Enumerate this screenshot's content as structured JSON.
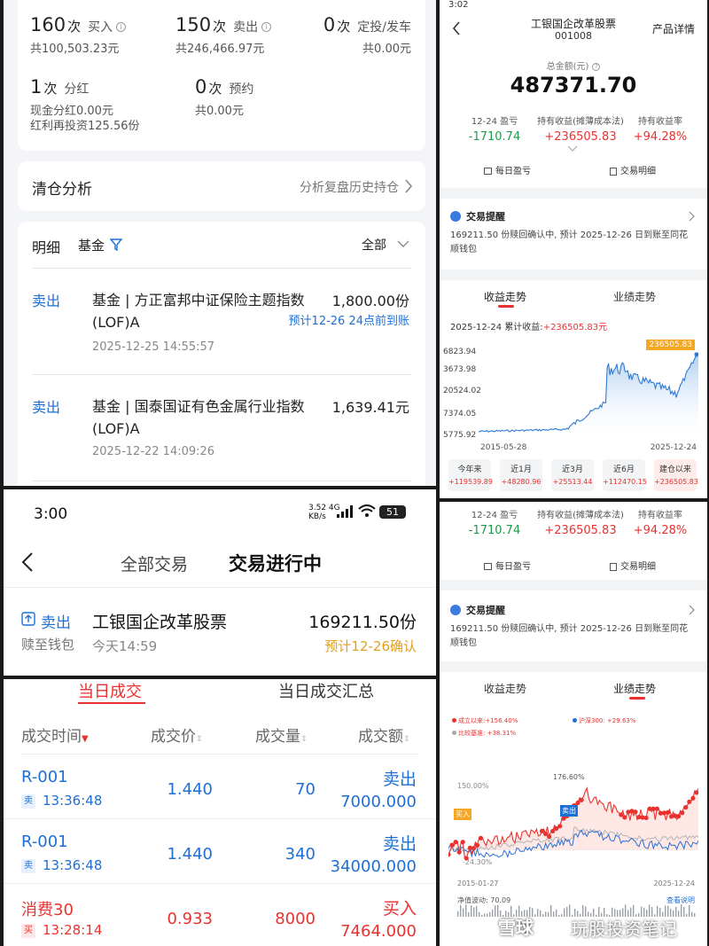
{
  "panel_a": {
    "stats": [
      {
        "count": "160",
        "unit": "次",
        "label": "买入",
        "sub": "共100,503.23元"
      },
      {
        "count": "150",
        "unit": "次",
        "label": "卖出",
        "sub": "共246,466.97元"
      },
      {
        "count": "0",
        "unit": "次",
        "label": "定投/发车",
        "sub": "共0.00元"
      },
      {
        "count": "1",
        "unit": "次",
        "label": "分红",
        "sub": "现金分红0.00元",
        "sub2": "红利再投资125.56份"
      },
      {
        "count": "0",
        "unit": "次",
        "label": "预约",
        "sub": "共0.00元"
      }
    ],
    "clear_title": "清仓分析",
    "clear_link": "分析复盘历史持仓",
    "detail_title": "明细",
    "detail_filter": "基金",
    "detail_all": "全部",
    "transactions": [
      {
        "action": "卖出",
        "name": "基金 | 方正富邦中证保险主题指数(LOF)A",
        "amount": "1,800.00份",
        "note": "预计12-26 24点前到账",
        "time": "2025-12-25 14:55:57"
      },
      {
        "action": "卖出",
        "name": "基金 | 国泰国证有色金属行业指数(LOF)A",
        "amount": "1,639.41元",
        "note": "",
        "time": "2025-12-22 14:09:26"
      }
    ]
  },
  "panel_b": {
    "status_time": "3:02",
    "fund_name": "工银国企改革股票",
    "fund_code": "001008",
    "detail_link": "产品详情",
    "total_label": "总金额(元)",
    "total_value": "487371.70",
    "metrics": [
      {
        "label": "12-24 盈亏",
        "value": "-1710.74"
      },
      {
        "label": "持有收益(摊薄成本法)",
        "value": "+236505.83"
      },
      {
        "label": "持有收益率",
        "value": "+94.28%"
      }
    ],
    "btn_daily": "每日盈亏",
    "btn_trade": "交易明细",
    "notice_title": "交易提醒",
    "notice_text": "169211.50 份赎回确认中, 预计 2025-12-26 日到账至同花顺钱包",
    "tab_profit": "收益走势",
    "tab_perf": "业绩走势",
    "chart_date": "2025-12-24",
    "chart_cum_label": "累计收益:",
    "chart_cum_value": "+236505.83元",
    "y_labels": [
      "6823.94",
      "3673.98",
      "20524.02",
      "7374.05",
      "5775.92"
    ],
    "x_start": "2015-05-28",
    "x_end": "2025-12-24",
    "badge": "236505.83",
    "periods": [
      {
        "label": "今年来",
        "value": "+119539.89"
      },
      {
        "label": "近1月",
        "value": "+48280.96"
      },
      {
        "label": "近3月",
        "value": "+25513.44"
      },
      {
        "label": "近6月",
        "value": "+112470.15"
      },
      {
        "label": "建仓以来",
        "value": "+236505.83"
      }
    ]
  },
  "panel_c": {
    "time": "3:00",
    "net_speed": "3.52",
    "net_unit": "KB/s",
    "net_type": "4G",
    "battery": "51",
    "tab_all": "全部交易",
    "tab_active": "交易进行中",
    "action": "卖出",
    "fund_name": "工银国企改革股票",
    "amount": "169211.50份",
    "sub_left": "赎至钱包",
    "sub_time": "今天14:59",
    "sub_right": "预计12-26确认"
  },
  "panel_d": {
    "tab1": "当日成交",
    "tab2": "当日成交汇总",
    "headers": [
      "成交时间",
      "成交价",
      "成交量",
      "成交额"
    ],
    "rows": [
      {
        "code": "R-001",
        "side": "卖",
        "time": "13:36:48",
        "price": "1.440",
        "qty": "70",
        "dir": "卖出",
        "amount": "7000.000",
        "color": "blue"
      },
      {
        "code": "R-001",
        "side": "卖",
        "time": "13:36:48",
        "price": "1.440",
        "qty": "340",
        "dir": "卖出",
        "amount": "34000.000",
        "color": "blue"
      },
      {
        "code": "消费30",
        "side": "买",
        "time": "13:28:14",
        "price": "0.933",
        "qty": "8000",
        "dir": "买入",
        "amount": "7464.000",
        "color": "red"
      }
    ]
  },
  "panel_e": {
    "metrics": [
      {
        "label": "12-24 盈亏",
        "value": "-1710.74"
      },
      {
        "label": "持有收益(摊薄成本法)",
        "value": "+236505.83"
      },
      {
        "label": "持有收益率",
        "value": "+94.28%"
      }
    ],
    "btn_daily": "每日盈亏",
    "btn_trade": "交易明细",
    "notice_title": "交易提醒",
    "notice_text": "169211.50 份赎回确认中, 预计 2025-12-26 日到账至同花顺钱包",
    "tab_profit": "收益走势",
    "tab_perf": "业绩走势",
    "legend": [
      {
        "label": "成立以来:+156.40%",
        "color": "#e8322f"
      },
      {
        "label": "沪深300: +29.63%",
        "color": "#1d6fd6"
      },
      {
        "label": "比较基准: +38.31%",
        "color": "#aaaaaa"
      }
    ],
    "y_top": "150.00%",
    "y_bottom": "-24.30%",
    "peak": "176.60%",
    "buy_tag": "买入",
    "sell_tag": "卖出",
    "x_start": "2015-01-27",
    "x_end": "2025-12-24",
    "nav_label": "净值波动",
    "nav_value": "70.09",
    "view_link": "查看说明"
  },
  "watermark": "雪球",
  "watermark2": "玩股投资笔记"
}
